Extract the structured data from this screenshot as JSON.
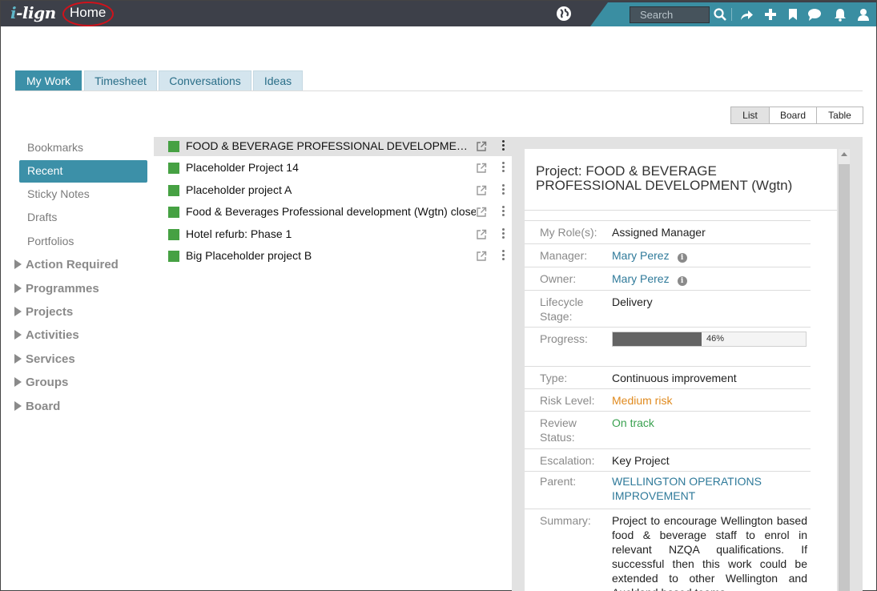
{
  "app": {
    "logo_prefix": "i",
    "logo_rest": "-lign",
    "page_title": "Home"
  },
  "topbar": {
    "search_placeholder": "Search",
    "icons": [
      "globe-icon",
      "search-icon",
      "share-icon",
      "add-icon",
      "bookmark-icon",
      "chat-icon",
      "bell-icon",
      "user-icon"
    ]
  },
  "tabs": [
    "My Work",
    "Timesheet",
    "Conversations",
    "Ideas"
  ],
  "views": [
    "List",
    "Board",
    "Table"
  ],
  "sidebar": {
    "items": [
      "Bookmarks",
      "Recent",
      "Sticky Notes",
      "Drafts",
      "Portfolios"
    ],
    "groups": [
      "Action Required",
      "Programmes",
      "Projects",
      "Activities",
      "Services",
      "Groups",
      "Board"
    ]
  },
  "projects": [
    "FOOD & BEVERAGE PROFESSIONAL DEVELOPMENT (Wgtn)",
    "Placeholder Project 14",
    "Placeholder project A",
    "Food & Beverages Professional development (Wgtn) closed",
    "Hotel refurb: Phase 1",
    "Big Placeholder project B"
  ],
  "detail": {
    "title": "Project: FOOD & BEVERAGE PROFESSIONAL DEVELOPMENT (Wgtn)",
    "labels": {
      "role": "My Role(s):",
      "manager": "Manager:",
      "owner": "Owner:",
      "lifecycle": "Lifecycle Stage:",
      "progress": "Progress:",
      "type": "Type:",
      "risk": "Risk Level:",
      "review": "Review Status:",
      "escalation": "Escalation:",
      "parent": "Parent:",
      "summary": "Summary:"
    },
    "values": {
      "role": "Assigned Manager",
      "manager": "Mary Perez",
      "owner": "Mary Perez",
      "lifecycle": "Delivery",
      "progress_text": "46%",
      "progress_value": 0.46,
      "type": "Continuous improvement",
      "risk": "Medium risk",
      "review": "On track",
      "escalation": "Key Project",
      "parent": "WELLINGTON OPERATIONS IMPROVEMENT",
      "summary": "Project to encourage Wellington based food & beverage staff to enrol in relevant NZQA qualifications. If successful then this work could be extended to other Wellington and Auckland based teams."
    }
  },
  "colors": {
    "topbar": "#3d4049",
    "accent": "#3c90a8",
    "status_green": "#46a143",
    "risk_orange": "#e08a1e",
    "highlight_circle": "#d0121b"
  }
}
